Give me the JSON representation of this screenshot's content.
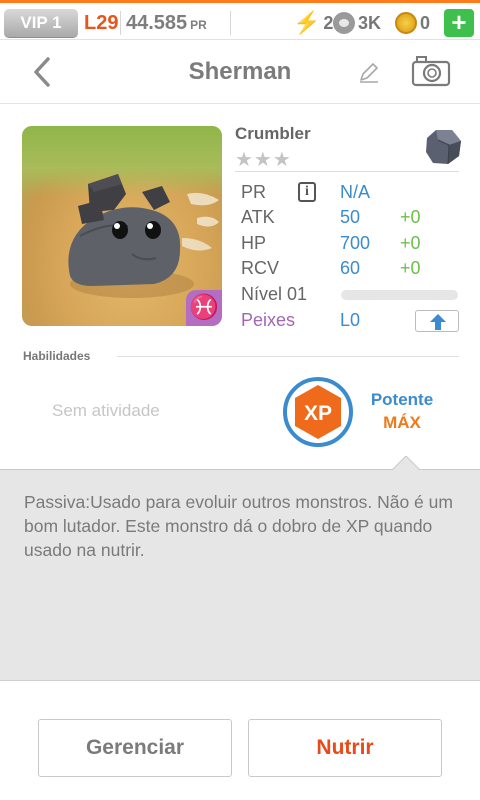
{
  "status_bar": {
    "vip": "VIP 1",
    "level": "L29",
    "pr_value": "44.585",
    "pr_unit": "PR",
    "energy": "2",
    "paw_points": "3K",
    "coins": "0",
    "add": "+",
    "accent_color": "#ff7a1a"
  },
  "header": {
    "title": "Sherman"
  },
  "monster": {
    "species": "Crumbler",
    "stars": "★★★",
    "sign_glyph": "♓",
    "stats": {
      "pr_label": "PR",
      "pr_value": "N/A",
      "info_glyph": "i",
      "atk_label": "ATK",
      "atk_value": "50",
      "atk_bonus": "+0",
      "hp_label": "HP",
      "hp_value": "700",
      "hp_bonus": "+0",
      "rcv_label": "RCV",
      "rcv_value": "60",
      "rcv_bonus": "+0",
      "level_label": "Nível 01",
      "level_progress": 0,
      "sign_label": "Peixes",
      "sign_level": "L0"
    }
  },
  "abilities": {
    "title": "Habilidades",
    "active": "Sem atividade",
    "xp_label": "XP",
    "passive_name": "Potente",
    "passive_level": "MÁX"
  },
  "description": "Passiva:Usado para evoluir outros monstros. Não é um bom lutador. Este monstro dá o dobro de XP quando usado na nutrir.",
  "buttons": {
    "manage": "Gerenciar",
    "feed": "Nutrir"
  },
  "colors": {
    "stat_value": "#3a8bd0",
    "stat_bonus": "#6cc04a",
    "feed": "#e84a1a",
    "xp_orange": "#ef6a1a"
  }
}
